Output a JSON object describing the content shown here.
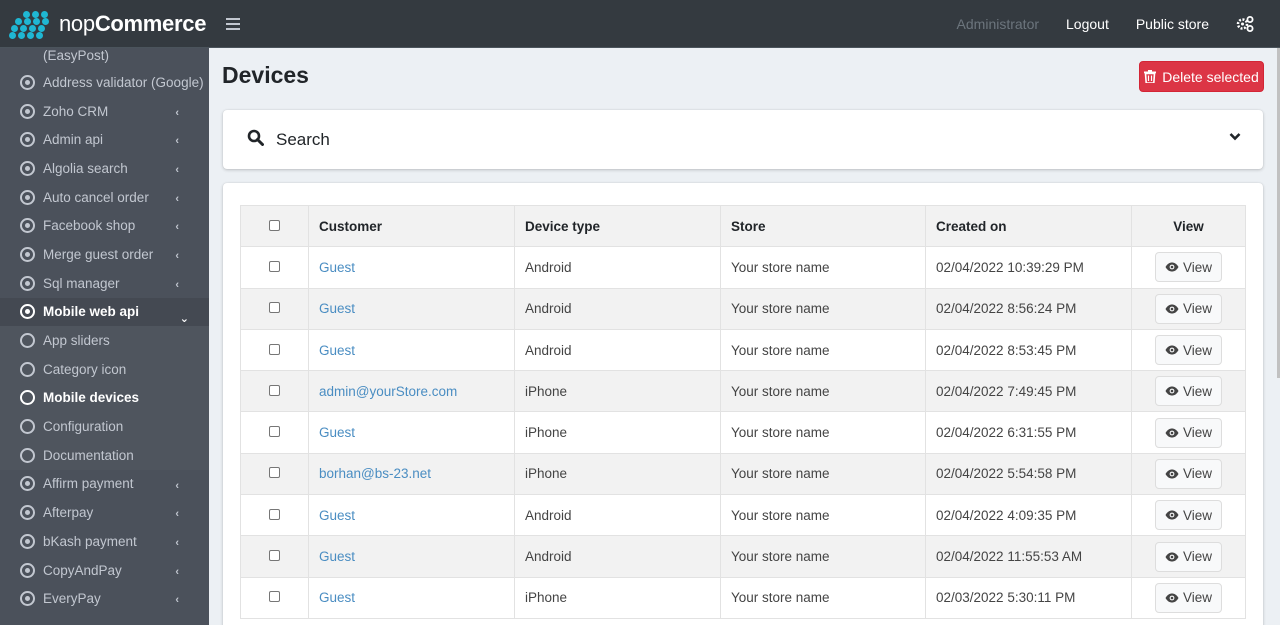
{
  "header": {
    "logo_light": "nop",
    "logo_bold": "Commerce",
    "admin_label": "Administrator",
    "logout_label": "Logout",
    "public_store_label": "Public store"
  },
  "sidebar": {
    "top_fragment": "(EasyPost)",
    "items": [
      {
        "label": "Address validator (Google)",
        "icon": "circle-dot-icon",
        "chevron": false
      },
      {
        "label": "Zoho CRM",
        "icon": "circle-dot-icon",
        "chevron": true
      },
      {
        "label": "Admin api",
        "icon": "circle-dot-icon",
        "chevron": true
      },
      {
        "label": "Algolia search",
        "icon": "circle-dot-icon",
        "chevron": true
      },
      {
        "label": "Auto cancel order",
        "icon": "circle-dot-icon",
        "chevron": true
      },
      {
        "label": "Facebook shop",
        "icon": "circle-dot-icon",
        "chevron": true
      },
      {
        "label": "Merge guest order",
        "icon": "circle-dot-icon",
        "chevron": true
      },
      {
        "label": "Sql manager",
        "icon": "circle-dot-icon",
        "chevron": true
      },
      {
        "label": "Mobile web api",
        "icon": "circle-dot-icon",
        "chevron": true,
        "open": true
      }
    ],
    "subitems": [
      {
        "label": "App sliders",
        "active": false
      },
      {
        "label": "Category icon",
        "active": false
      },
      {
        "label": "Mobile devices",
        "active": true
      },
      {
        "label": "Configuration",
        "active": false
      },
      {
        "label": "Documentation",
        "active": false
      }
    ],
    "items_after": [
      {
        "label": "Affirm payment"
      },
      {
        "label": "Afterpay"
      },
      {
        "label": "bKash payment"
      },
      {
        "label": "CopyAndPay"
      },
      {
        "label": "EveryPay"
      }
    ]
  },
  "main": {
    "title": "Devices",
    "delete_selected_label": "Delete selected",
    "search_label": "Search",
    "columns": [
      "Customer",
      "Device type",
      "Store",
      "Created on",
      "View"
    ],
    "view_label": "View",
    "rows": [
      {
        "customer": "Guest",
        "device_type": "Android",
        "store": "Your store name",
        "created_on": "02/04/2022 10:39:29 PM"
      },
      {
        "customer": "Guest",
        "device_type": "Android",
        "store": "Your store name",
        "created_on": "02/04/2022 8:56:24 PM"
      },
      {
        "customer": "Guest",
        "device_type": "Android",
        "store": "Your store name",
        "created_on": "02/04/2022 8:53:45 PM"
      },
      {
        "customer": "admin@yourStore.com",
        "device_type": "iPhone",
        "store": "Your store name",
        "created_on": "02/04/2022 7:49:45 PM"
      },
      {
        "customer": "Guest",
        "device_type": "iPhone",
        "store": "Your store name",
        "created_on": "02/04/2022 6:31:55 PM"
      },
      {
        "customer": "borhan@bs-23.net",
        "device_type": "iPhone",
        "store": "Your store name",
        "created_on": "02/04/2022 5:54:58 PM"
      },
      {
        "customer": "Guest",
        "device_type": "Android",
        "store": "Your store name",
        "created_on": "02/04/2022 4:09:35 PM"
      },
      {
        "customer": "Guest",
        "device_type": "Android",
        "store": "Your store name",
        "created_on": "02/04/2022 11:55:53 AM"
      },
      {
        "customer": "Guest",
        "device_type": "iPhone",
        "store": "Your store name",
        "created_on": "02/03/2022 5:30:11 PM"
      }
    ]
  },
  "colors": {
    "brand": "#1fb7d3",
    "danger": "#dc3545",
    "link": "#4a8dc2",
    "sidebar_bg": "#4b515b",
    "topbar_bg": "#343a40"
  }
}
